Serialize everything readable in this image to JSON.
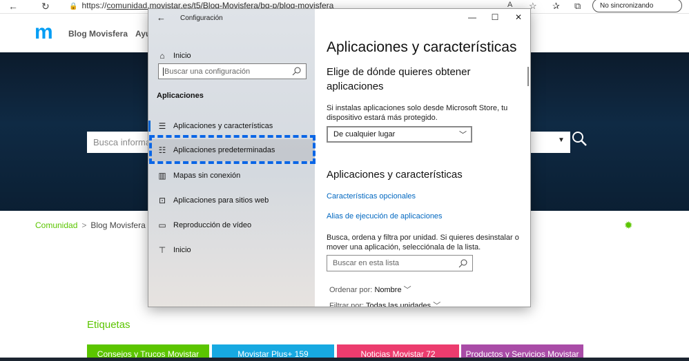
{
  "browser": {
    "url_prefix": "https://",
    "url_host": "comunidad.movistar.es",
    "url_path": "/t5/Blog-Movisfera/bg-p/blog-movisfera",
    "sync_label": "No sincronizando",
    "font_label": "A",
    "nav_icons": [
      "back-icon",
      "refresh-icon",
      "home-icon"
    ]
  },
  "site": {
    "logo": "m",
    "blog_title": "Blog Movisfera",
    "nav_partial": "Ayu",
    "search_placeholder": "Busca informa",
    "breadcrumb": {
      "community": "Comunidad",
      "separator": ">",
      "current": "Blog Movisfera"
    },
    "etiquetas_title": "Etiquetas",
    "tags": [
      {
        "label": "Consejos y Trucos Movistar",
        "color": "#5bc500"
      },
      {
        "label": "Movistar Plus+ 159",
        "color": "#17a9e1"
      },
      {
        "label": "Noticias Movistar 72",
        "color": "#ec3c6e"
      },
      {
        "label": "Productos y Servicios Movistar",
        "color": "#a94ca7"
      }
    ]
  },
  "settings": {
    "title": "Configuración",
    "controls": {
      "minimize": "—",
      "maximize": "☐",
      "close": "✕"
    },
    "sidebar": {
      "home": "Inicio",
      "search_placeholder": "Buscar una configuración",
      "section": "Aplicaciones",
      "items": [
        {
          "label": "Aplicaciones y características",
          "icon": "list-icon"
        },
        {
          "label": "Aplicaciones predeterminadas",
          "icon": "default-apps-icon"
        },
        {
          "label": "Mapas sin conexión",
          "icon": "map-icon"
        },
        {
          "label": "Aplicaciones para sitios web",
          "icon": "web-app-icon"
        },
        {
          "label": "Reproducción de vídeo",
          "icon": "video-icon"
        },
        {
          "label": "Inicio",
          "icon": "startup-icon"
        }
      ]
    },
    "main": {
      "title": "Aplicaciones y características",
      "source_heading_1": "Elige de dónde quieres obtener",
      "source_heading_2": "aplicaciones",
      "source_text_1": "Si instalas aplicaciones solo desde Microsoft Store, tu",
      "source_text_2": "dispositivo estará más protegido.",
      "source_dropdown": "De cualquier lugar",
      "apps_heading": "Aplicaciones y características",
      "link_optional": "Características opcionales",
      "link_aliases": "Alias de ejecución de aplicaciones",
      "search_text_1": "Busca, ordena y filtra por unidad. Si quieres desinstalar o",
      "search_text_2": "mover una aplicación, selecciónala de la lista.",
      "list_search_placeholder": "Buscar en esta lista",
      "sort_label": "Ordenar por:",
      "sort_value": "Nombre",
      "filter_label": "Filtrar por:",
      "filter_value": "Todas las unidades"
    }
  },
  "colors": {
    "accent": "#0067c0",
    "highlight": "#0a66e6",
    "movistar_green": "#5bc500",
    "movistar_blue": "#019df4"
  }
}
